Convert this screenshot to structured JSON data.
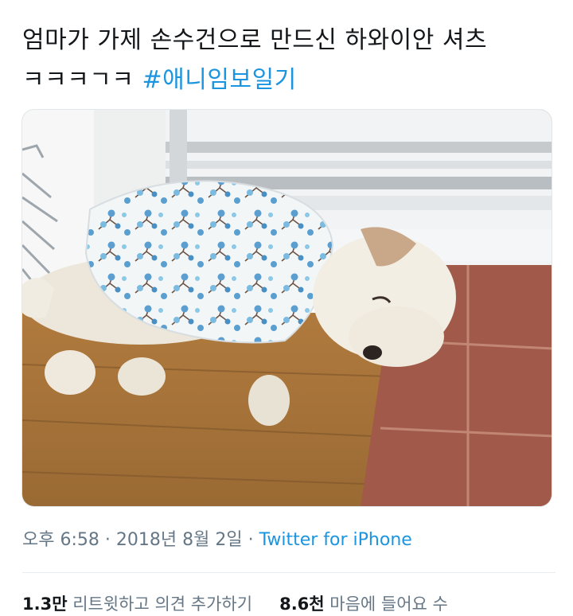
{
  "tweet": {
    "line1": "엄마가 가제 손수건으로 만드신 하와이안 셔츠",
    "line2_prefix": "ㅋㅋㅋㄱㅋ ",
    "hashtag": "#애니임보일기"
  },
  "meta": {
    "time": "오후 6:58",
    "separator": " · ",
    "date": "2018년 8월 2일",
    "source": "Twitter for iPhone"
  },
  "stats": {
    "retweets_count": "1.3만",
    "retweets_label": " 리트윗하고 의견 추가하기",
    "likes_count": "8.6천",
    "likes_label": " 마음에 들어요 수"
  },
  "colors": {
    "text": "#14171a",
    "link": "#1b95e0",
    "secondary": "#657786"
  }
}
